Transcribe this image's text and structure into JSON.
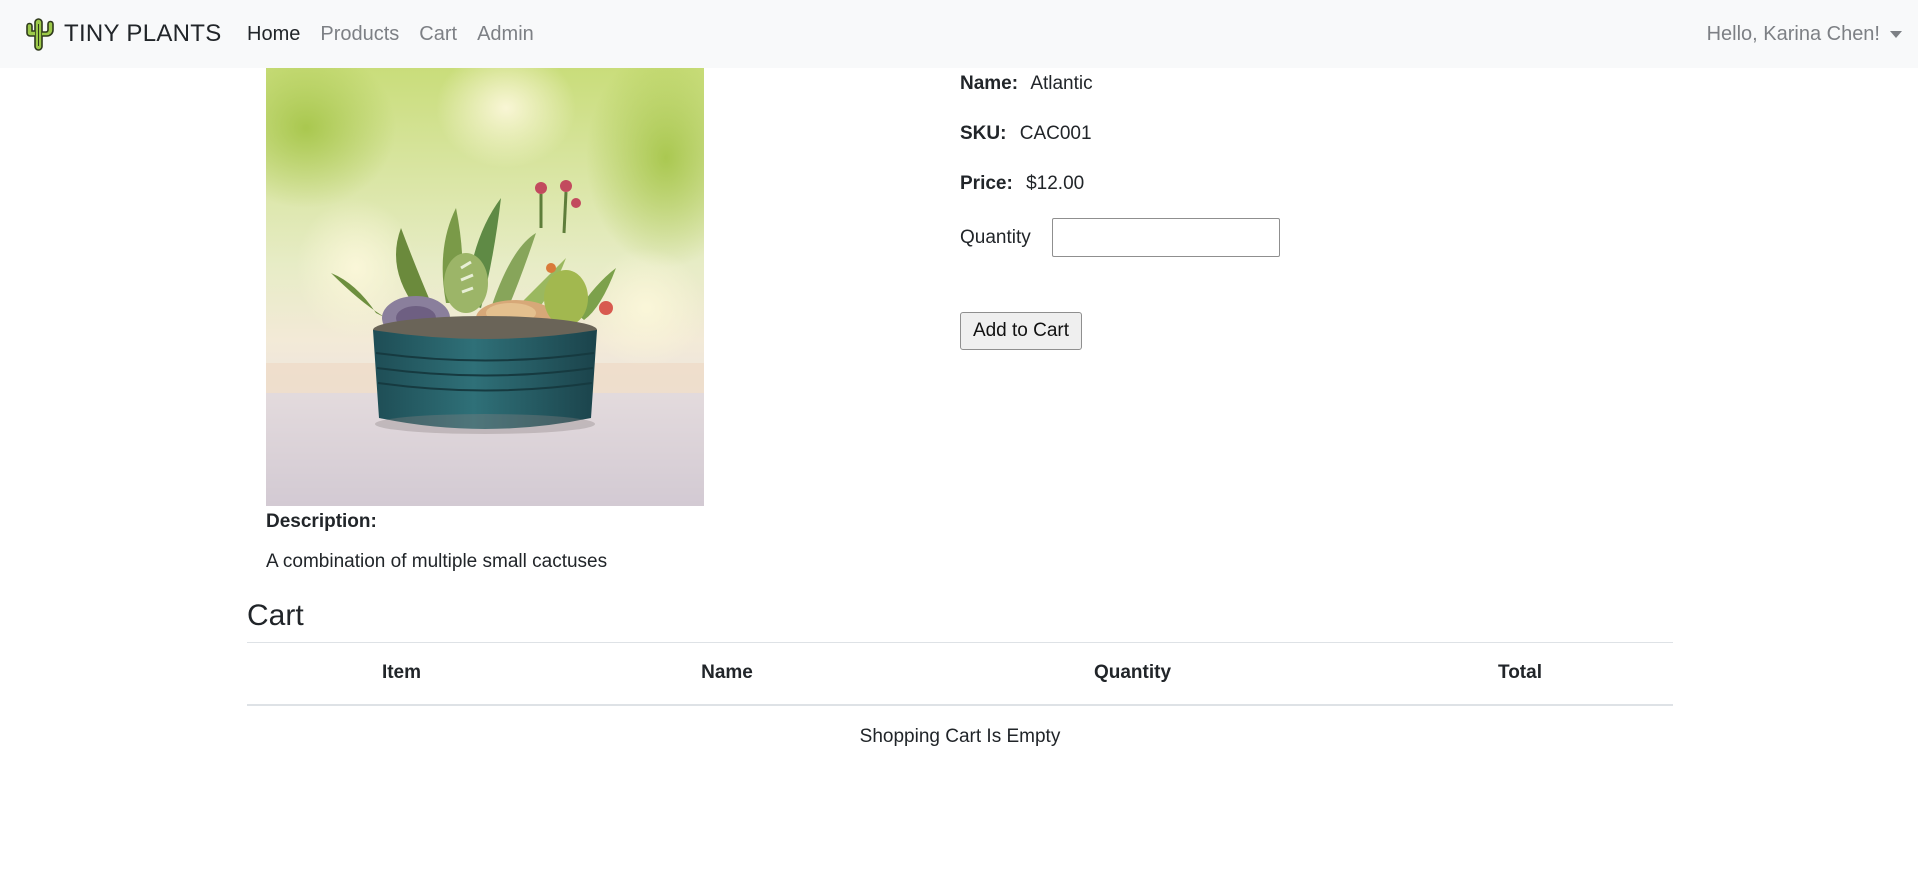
{
  "navbar": {
    "brand": "TINY PLANTS",
    "links": [
      "Home",
      "Products",
      "Cart",
      "Admin"
    ],
    "user_greeting": "Hello, Karina Chen!"
  },
  "product": {
    "name_label": "Name:",
    "name": "Atlantic",
    "sku_label": "SKU:",
    "sku": "CAC001",
    "price_label": "Price:",
    "price": "$12.00",
    "quantity_label": "Quantity",
    "quantity_value": "",
    "add_button": "Add to Cart",
    "description_label": "Description:",
    "description": "A combination of multiple small cactuses"
  },
  "cart": {
    "title": "Cart",
    "columns": [
      "Item",
      "Name",
      "Quantity",
      "Total"
    ],
    "empty_message": "Shopping Cart Is Empty"
  },
  "icons": {
    "brand": "cactus-icon",
    "user_menu": "caret-down-icon"
  },
  "colors": {
    "navbar_bg": "#f8f9fa",
    "muted_link": "#7d8085",
    "pot": "#2e6a70"
  }
}
